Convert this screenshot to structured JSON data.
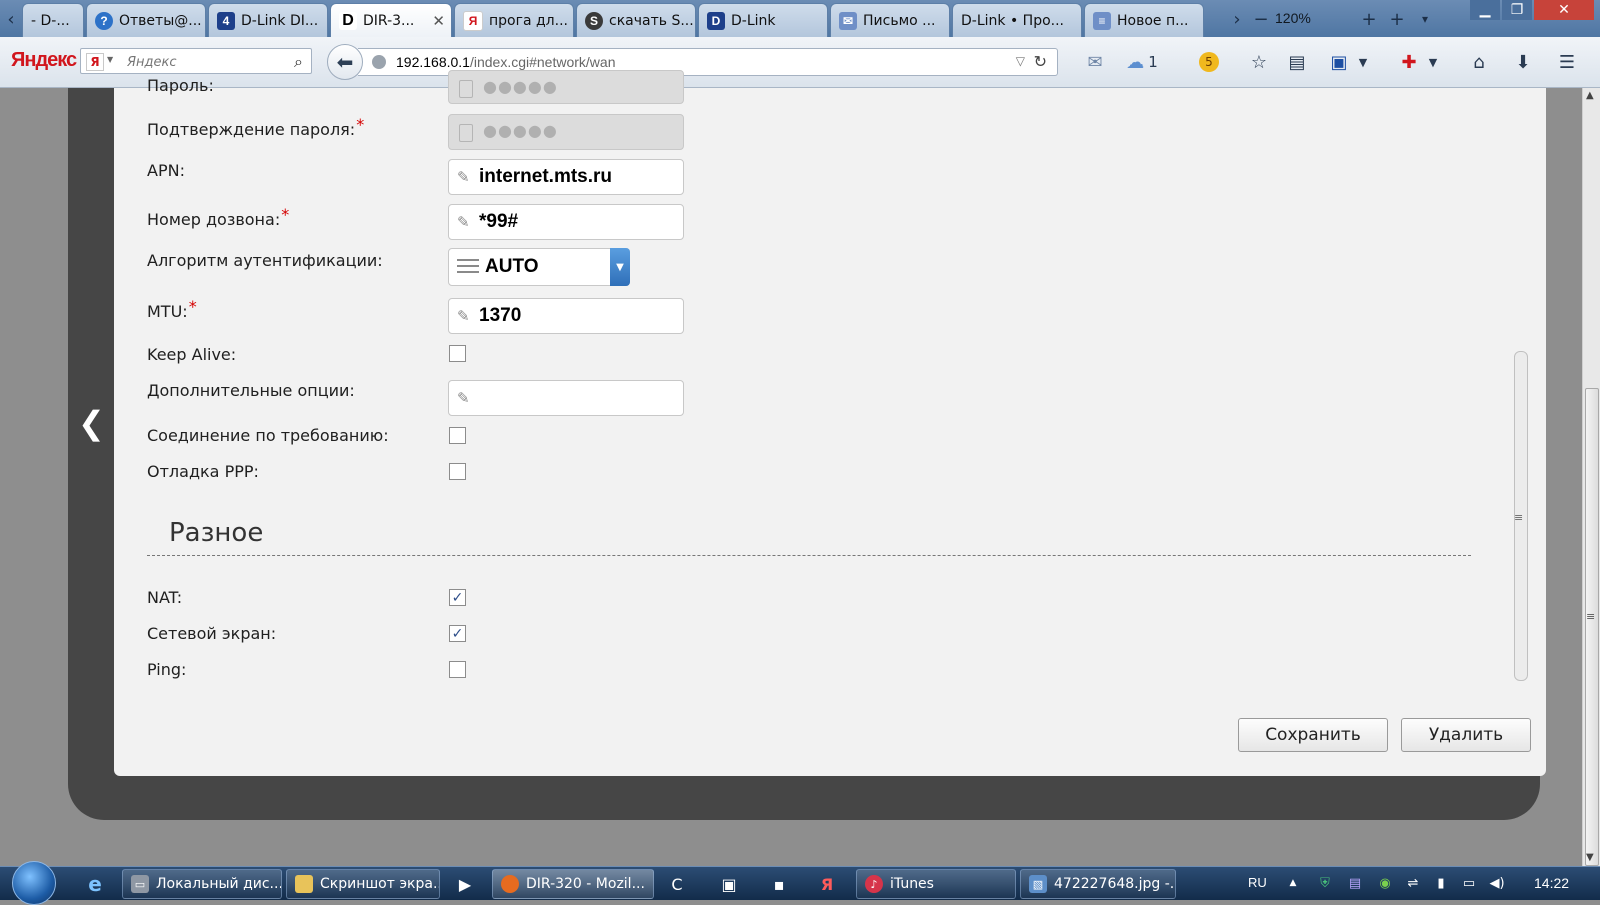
{
  "browser": {
    "tabs": [
      {
        "label": "- D-...",
        "icon": "dlink-icon",
        "active": false
      },
      {
        "label": "Ответы@...",
        "icon": "question-icon",
        "active": false
      },
      {
        "label": "D-Link DI...",
        "icon": "dlink-icon",
        "active": false
      },
      {
        "label": "DIR-3...",
        "icon": "dlink-d-icon",
        "active": true
      },
      {
        "label": "прога дл...",
        "icon": "yandex-icon",
        "active": false
      },
      {
        "label": "скачать S...",
        "icon": "app-icon",
        "active": false
      },
      {
        "label": "D-Link",
        "icon": "dlink-d-icon",
        "active": false
      },
      {
        "label": "Письмо ...",
        "icon": "mail-icon",
        "active": false
      },
      {
        "label": "D-Link • Про...",
        "icon": "none",
        "active": false
      },
      {
        "label": "Новое п...",
        "icon": "document-icon",
        "active": false
      }
    ],
    "zoom": "120%",
    "address": {
      "host": "192.168.0.1",
      "path": "/index.cgi#network/wan"
    },
    "yandex": {
      "logo": "Яндекс",
      "search_placeholder": "Яндекс"
    },
    "toolbar": {
      "cloud_count": "1",
      "coin_count": "5"
    }
  },
  "form": {
    "password_label": "Пароль:",
    "confirm_password_label": "Подтверждение пароля:",
    "confirm_password_mask": "●●●●●",
    "password_mask": "●●●●●",
    "apn_label": "APN:",
    "apn_value": "internet.mts.ru",
    "dial_number_label": "Номер дозвона:",
    "dial_number_value": "*99#",
    "auth_algorithm_label": "Алгоритм аутентификации:",
    "auth_algorithm_value": "AUTO",
    "mtu_label": "MTU:",
    "mtu_value": "1370",
    "keep_alive_label": "Keep Alive:",
    "keep_alive_checked": false,
    "extra_options_label": "Дополнительные опции:",
    "extra_options_value": "",
    "on_demand_label": "Соединение по требованию:",
    "on_demand_checked": false,
    "ppp_debug_label": "Отладка PPP:",
    "ppp_debug_checked": false,
    "required_mark": "*"
  },
  "misc": {
    "title": "Разное",
    "nat_label": "NAT:",
    "nat_checked": true,
    "firewall_label": "Сетевой экран:",
    "firewall_checked": true,
    "ping_label": "Ping:",
    "ping_checked": false
  },
  "buttons": {
    "save": "Сохранить",
    "delete": "Удалить"
  },
  "taskbar": {
    "items": [
      {
        "label": "Локальный дис...",
        "icon": "drive-icon"
      },
      {
        "label": "Скриншот экра...",
        "icon": "folder-icon"
      },
      {
        "label": "DIR-320 - Mozil...",
        "icon": "firefox-icon"
      },
      {
        "label": "iTunes",
        "icon": "itunes-icon"
      },
      {
        "label": "472227648.jpg -...",
        "icon": "image-viewer-icon"
      }
    ],
    "language": "RU",
    "clock": "14:22"
  },
  "colors": {
    "required": "#d40000",
    "panel_bg": "#f2f2f2",
    "frame_bg": "#464646",
    "select_arrow": "#2f6fb8"
  }
}
